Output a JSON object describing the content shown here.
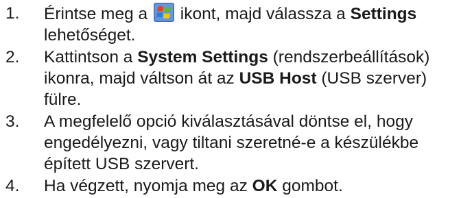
{
  "steps": [
    {
      "number": "1.",
      "line1_pre": "Érintse meg a ",
      "icon": "windows-start-icon",
      "line1_mid": " ikont, majd válassza a ",
      "line1_bold": "Settings",
      "line2": "lehetőséget."
    },
    {
      "number": "2.",
      "line1_pre": "Kattintson a ",
      "line1_bold": "System Settings",
      "line1_post": " (rendszerbeállítások)",
      "line2_pre": "ikonra, majd váltson át az ",
      "line2_bold": "USB Host",
      "line2_post": " (USB szerver)",
      "line3": "fülre."
    },
    {
      "number": "3.",
      "line1": "A megfelelő opció kiválasztásával döntse el, hogy",
      "line2": "engedélyezni, vagy tiltani szeretné-e a készülékbe",
      "line3": "épített USB szervert."
    },
    {
      "number": "4.",
      "line1_pre": "Ha végzett, nyomja meg az ",
      "line1_bold": "OK",
      "line1_post": " gombot."
    }
  ],
  "colors": {
    "text": "#1a1a1a",
    "logo_red": "#e8401c",
    "logo_green": "#5fb63a",
    "logo_blue": "#2a7fd6",
    "logo_yellow": "#f7c320",
    "logo_bg": "#3d6fbf"
  }
}
